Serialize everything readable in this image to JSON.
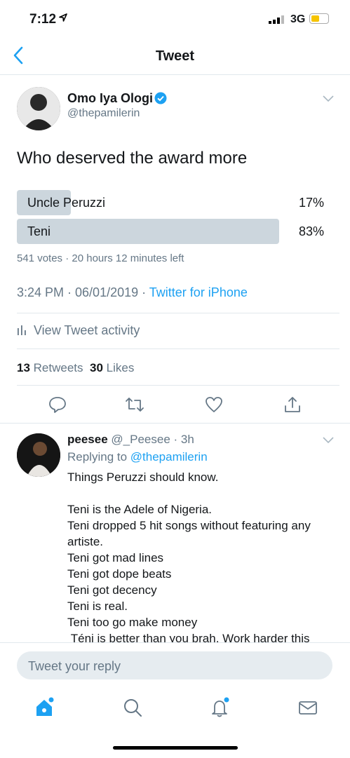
{
  "status_bar": {
    "time": "7:12",
    "network": "3G",
    "colors": {
      "battery": "#f6c400"
    }
  },
  "nav": {
    "title": "Tweet"
  },
  "tweet": {
    "author_name": "Omo Iya Ologi",
    "author_handle": "@thepamilerin",
    "text": "Who deserved the award more",
    "poll": {
      "options": [
        {
          "label": "Uncle Peruzzi",
          "percent": "17%",
          "fraction": 0.17
        },
        {
          "label": "Teni",
          "percent": "83%",
          "fraction": 0.83
        }
      ],
      "meta": "541 votes · 20 hours 12 minutes left"
    },
    "timestamp": "3:24 PM · 06/01/2019 · ",
    "source": "Twitter for iPhone",
    "activity_label": "View Tweet activity",
    "retweets_count": "13",
    "retweets_label": "Retweets",
    "likes_count": "30",
    "likes_label": "Likes"
  },
  "actions": [
    "reply-icon",
    "retweet-icon",
    "like-icon",
    "share-icon"
  ],
  "reply": {
    "author_name": "peesee",
    "author_meta": "@_Peesee · 3h",
    "replying_prefix": "Replying to ",
    "replying_to": "@thepamilerin",
    "text": "Things Peruzzi should know.\n\nTeni is the Adele of Nigeria.\nTeni dropped 5 hit songs without featuring any artiste.\nTeni got mad lines\nTeni got dope beats\nTeni got decency\nTeni is real.\nTeni too go make money\n Téni is better than you brah, Work harder this"
  },
  "compose": {
    "placeholder": "Tweet your reply"
  },
  "tab_bar": [
    "home-icon",
    "search-icon",
    "notifications-icon",
    "messages-icon"
  ],
  "colors": {
    "accent": "#1da1f2",
    "secondary_text": "#657786",
    "poll_bar": "#ccd6dd"
  }
}
